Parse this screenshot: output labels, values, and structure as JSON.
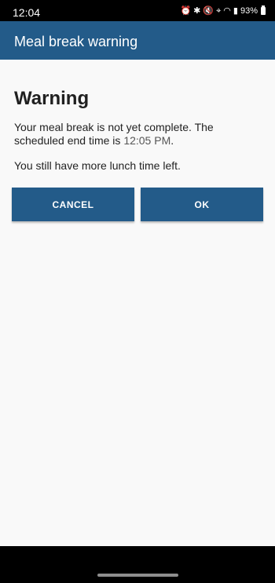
{
  "status_bar": {
    "time": "12:04",
    "battery": "93%",
    "icons": [
      "alarm-icon",
      "bluetooth-icon",
      "mute-icon",
      "location-icon",
      "wifi-icon",
      "signal-icon",
      "battery-icon"
    ]
  },
  "app_bar": {
    "title": "Meal break warning",
    "color": "#235b89"
  },
  "dialog": {
    "heading": "Warning",
    "message_prefix": "Your meal break is not yet complete. The scheduled end time is ",
    "end_time": "12:05 PM",
    "message_suffix": ".",
    "message2": "You still have more lunch time left.",
    "cancel_label": "CANCEL",
    "ok_label": "OK"
  }
}
